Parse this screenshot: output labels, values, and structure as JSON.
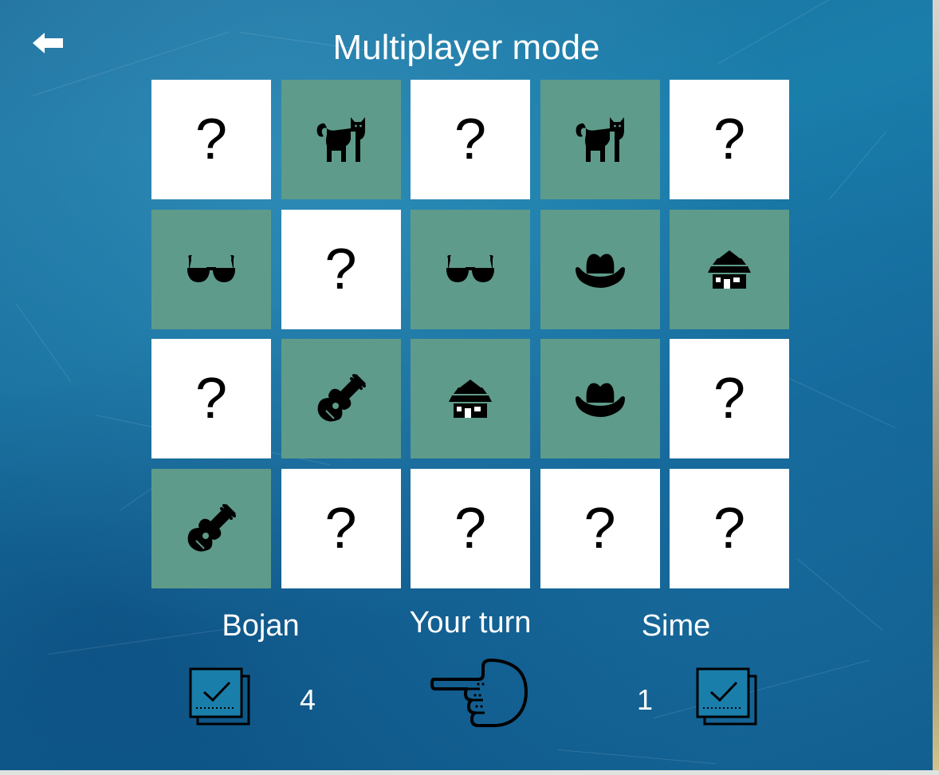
{
  "header": {
    "title": "Multiplayer mode",
    "back_icon": "arrow-left-icon"
  },
  "colors": {
    "background": "#1a7eab",
    "card_hidden": "#ffffff",
    "card_revealed": "#5f9b8a",
    "text": "#ffffff"
  },
  "board": {
    "rows": 4,
    "cols": 5,
    "cards": [
      {
        "state": "hidden",
        "symbol": "?"
      },
      {
        "state": "revealed",
        "icon": "cat-icon"
      },
      {
        "state": "hidden",
        "symbol": "?"
      },
      {
        "state": "revealed",
        "icon": "cat-icon"
      },
      {
        "state": "hidden",
        "symbol": "?"
      },
      {
        "state": "revealed",
        "icon": "sunglasses-icon"
      },
      {
        "state": "hidden",
        "symbol": "?"
      },
      {
        "state": "revealed",
        "icon": "sunglasses-icon"
      },
      {
        "state": "revealed",
        "icon": "cowboy-hat-icon"
      },
      {
        "state": "revealed",
        "icon": "hut-icon"
      },
      {
        "state": "hidden",
        "symbol": "?"
      },
      {
        "state": "revealed",
        "icon": "guitar-icon"
      },
      {
        "state": "revealed",
        "icon": "hut-icon"
      },
      {
        "state": "revealed",
        "icon": "cowboy-hat-icon"
      },
      {
        "state": "hidden",
        "symbol": "?"
      },
      {
        "state": "revealed",
        "icon": "guitar-icon"
      },
      {
        "state": "hidden",
        "symbol": "?"
      },
      {
        "state": "hidden",
        "symbol": "?"
      },
      {
        "state": "hidden",
        "symbol": "?"
      },
      {
        "state": "hidden",
        "symbol": "?"
      }
    ]
  },
  "players": {
    "left": {
      "name": "Bojan",
      "score": "4",
      "score_icon": "matched-pairs-icon"
    },
    "right": {
      "name": "Sime",
      "score": "1",
      "score_icon": "matched-pairs-icon"
    }
  },
  "turn": {
    "label": "Your turn",
    "pointer_icon": "pointing-hand-left-icon",
    "pointing_to": "left"
  }
}
